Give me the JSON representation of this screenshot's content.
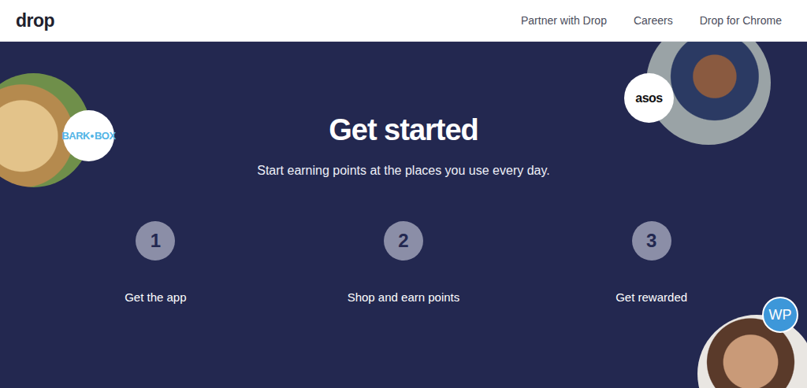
{
  "nav": {
    "logo": "drop",
    "links": [
      "Partner with Drop",
      "Careers",
      "Drop for Chrome"
    ]
  },
  "hero": {
    "title": "Get started",
    "subtitle": "Start earning points at the places you use every day."
  },
  "steps": [
    {
      "number": "1",
      "label": "Get the app"
    },
    {
      "number": "2",
      "label": "Shop and earn points"
    },
    {
      "number": "3",
      "label": "Get rewarded"
    }
  ],
  "brands": [
    {
      "kind": "barkbox",
      "first": "BARK",
      "second": "BOX"
    },
    {
      "kind": "asos",
      "first": "asos"
    },
    {
      "kind": "wp",
      "first": "WP"
    }
  ]
}
